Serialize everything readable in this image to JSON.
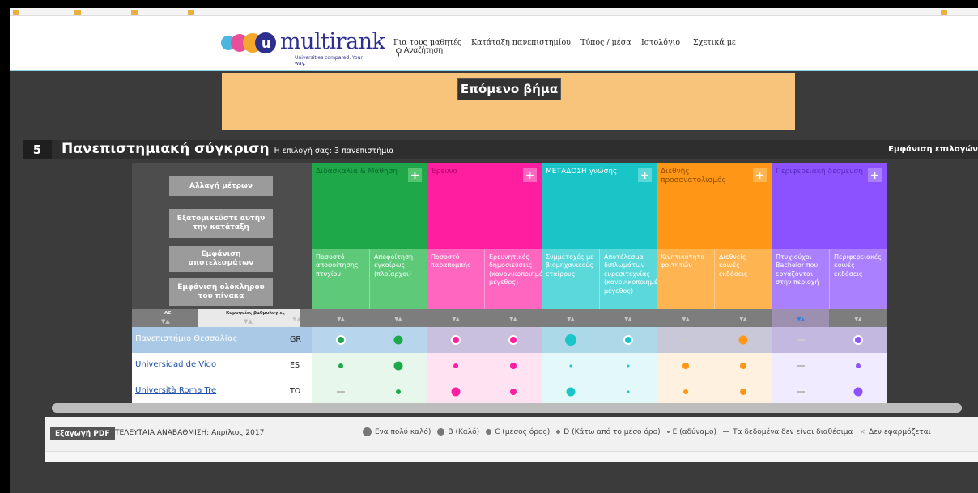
{
  "header": {
    "logo_word": "multirank",
    "logo_tagline": "Universities compared. Your way.",
    "nav": {
      "students": "Για τους μαθητές",
      "search": "Αναζήτηση",
      "ranking": "Κατάταξη πανεπιστημίου",
      "media": "Τύπος / μέσα",
      "blog": "Ιστολόγιο",
      "about": "Σχετικά με"
    }
  },
  "banner": {
    "next_step": "Επόμενο βήμα"
  },
  "section": {
    "number": "5",
    "title": "Πανεπιστημιακή σύγκριση",
    "subtitle": "Η επιλογή σας: 3 πανεπιστήμια",
    "show_selection": "Εμφάνιση επιλογών"
  },
  "left_buttons": {
    "change_measures": "Αλλαγή μέτρων",
    "customize": "Εξατομικεύστε αυτήν την κατάταξη",
    "show_results": "Εμφάνιση αποτελεσμάτων",
    "show_table": "Εμφάνιση ολόκληρου του πίνακα"
  },
  "sort_labels": {
    "az": "AZ",
    "top": "Κορυφαίες βαθμολογίες"
  },
  "categories": [
    {
      "label": "Διδασκαλία & Μάθηση",
      "color": "#1fa84a",
      "plus_color": "#57c46f",
      "text_color": "#0b6a2a"
    },
    {
      "label": "Έρευνα",
      "color": "#ff1da0",
      "plus_color": "#ff66c0",
      "text_color": "#b8006e"
    },
    {
      "label": "ΜΕΤΑΔΟΣΗ γνώσης",
      "color": "#1ac5c8",
      "plus_color": "#5ad8da",
      "text_color": "#ffffff"
    },
    {
      "label": "Διεθνής προσανατολισμός",
      "color": "#ff9616",
      "plus_color": "#ffb452",
      "text_color": "#8a4b00"
    },
    {
      "label": "Περιφερειακή δέσμευση",
      "color": "#8c52ff",
      "plus_color": "#aa80ff",
      "text_color": "#5a2cc0"
    }
  ],
  "indicators": [
    {
      "label": "Ποσοστό αποφοίτησης πτυχίου",
      "bg": "#5fc97a"
    },
    {
      "label": "Αποφοίτηση εγκαίρως (πλοίαρχοι)",
      "bg": "#5fc97a"
    },
    {
      "label": "Ποσοστό παραπομπής",
      "bg": "#ff66c0"
    },
    {
      "label": "Ερευνητικές δημοσιεύσεις (κανονικοποιημένο μέγεθος)",
      "bg": "#ff66c0"
    },
    {
      "label": "Συμμετοχές με βιομηχανικούς εταίρους",
      "bg": "#5ad8da"
    },
    {
      "label": "Αποτέλεσμα διπλωμάτων ευρεσιτεχνίας (κανονικοποιημένο μέγεθος)",
      "bg": "#5ad8da"
    },
    {
      "label": "Κινητικότητα φοιτητών",
      "bg": "#ffb452"
    },
    {
      "label": "Διεθνείς κοινές εκδόσεις",
      "bg": "#ffb452"
    },
    {
      "label": "Πτυχιούχοι Bachelor που εργάζονται στην περιοχή",
      "bg": "#aa80ff"
    },
    {
      "label": "Περιφερειακές κοινές εκδόσεις",
      "bg": "#aa80ff"
    }
  ],
  "rows": [
    {
      "name": "Πανεπιστήμιο Θεσσαλίας",
      "country": "GR",
      "highlight": true,
      "grades": [
        "C",
        "B",
        "C",
        "C",
        "A",
        "C",
        "NA",
        "B",
        "NA",
        "C"
      ]
    },
    {
      "name": "Universidad de Vigo",
      "country": "ES",
      "highlight": false,
      "grades": [
        "D",
        "B",
        "D",
        "C",
        "E",
        "E",
        "C",
        "C",
        "NA",
        "D"
      ]
    },
    {
      "name": "Università Roma Tre",
      "country": "TO",
      "highlight": false,
      "grades": [
        "NA",
        "D",
        "B",
        "C",
        "B",
        "E",
        "D",
        "C",
        "NA",
        "B"
      ]
    }
  ],
  "footer": {
    "export_pdf": "Εξαγωγή PDF",
    "last_update": "ΤΕΛΕΥΤΑΙΑ ΑΝΑΒΑΘΜΙΣΗ: Απρίλιος 2017",
    "legend": [
      {
        "label": "Ενα πολύ καλό)"
      },
      {
        "label": "Β (Καλό)"
      },
      {
        "label": "C (μέσος όρος)"
      },
      {
        "label": "D (Κάτω από το μέσο όρο)"
      },
      {
        "label": "E (αδύναμο)"
      },
      {
        "label": "Τα δεδομένα δεν είναι διαθέσιμα"
      },
      {
        "label": "Δεν εφαρμόζεται"
      }
    ]
  }
}
